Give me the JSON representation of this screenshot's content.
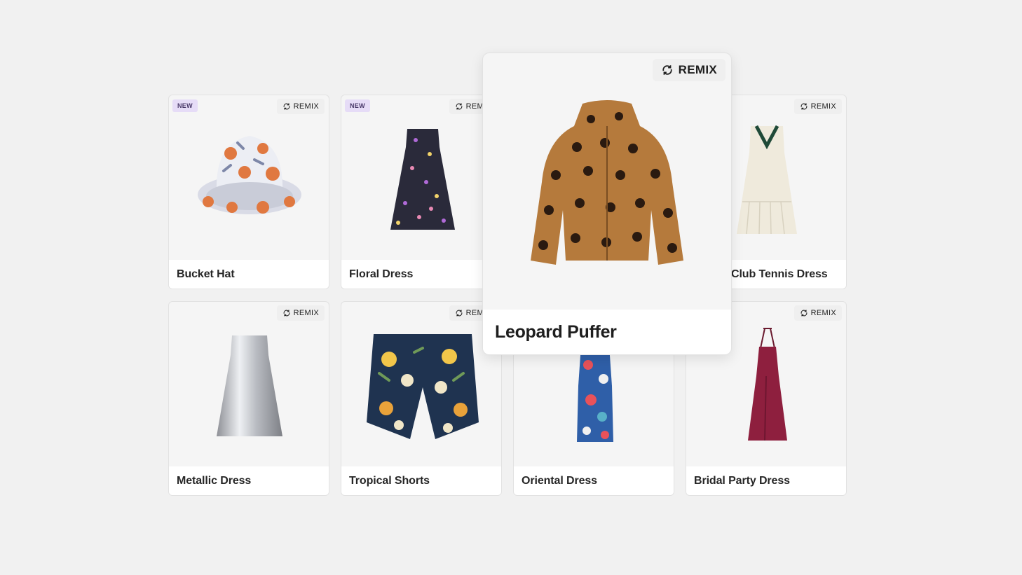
{
  "remix_label": "REMIX",
  "new_label": "NEW",
  "cards": [
    {
      "title": "Bucket Hat",
      "is_new": true
    },
    {
      "title": "Floral Dress",
      "is_new": true
    },
    {
      "title": "Club Tennis Dress",
      "is_new": false
    },
    {
      "title": "Metallic Dress",
      "is_new": false
    },
    {
      "title": "Tropical Shorts",
      "is_new": false
    },
    {
      "title": "Oriental Dress",
      "is_new": false
    },
    {
      "title": "Bridal Party Dress",
      "is_new": false
    }
  ],
  "featured": {
    "title": "Leopard Puffer",
    "remix_label": "REMIX"
  },
  "colors": {
    "background": "#f1f1f1",
    "card": "#f5f5f5",
    "new_badge": "#e6dcf7",
    "remix_chip": "#efefef"
  }
}
